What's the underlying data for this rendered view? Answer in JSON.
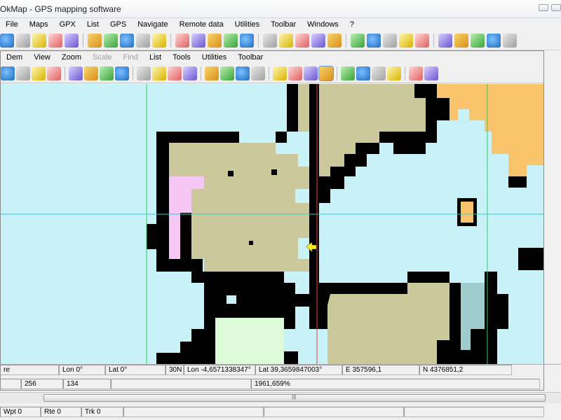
{
  "window": {
    "title": "OkMap - GPS mapping software"
  },
  "menubar": [
    "File",
    "Maps",
    "GPX",
    "List",
    "GPS",
    "Navigate",
    "Remote data",
    "Utilities",
    "Toolbar",
    "Windows",
    "?"
  ],
  "inner_menubar": [
    {
      "label": "Dem",
      "dim": false
    },
    {
      "label": "View",
      "dim": false
    },
    {
      "label": "Zoom",
      "dim": false
    },
    {
      "label": "Scale",
      "dim": true
    },
    {
      "label": "Find",
      "dim": true
    },
    {
      "label": "List",
      "dim": false
    },
    {
      "label": "Tools",
      "dim": false
    },
    {
      "label": "Utilities",
      "dim": false
    },
    {
      "label": "Toolbar",
      "dim": false
    }
  ],
  "main_toolbar_icons": [
    "open-map-icon",
    "save-map-icon",
    "calibrate-icon",
    "ecw-icon",
    "drg-icon",
    "georef-icon",
    "gps-receive-icon",
    "gps-send-icon",
    "gps-track-icon",
    "globe-icon",
    "globe-settings-icon",
    "layer-add-icon",
    "layer-remove-icon",
    "route-icon",
    "waypoint-icon",
    "track-icon",
    "measure-icon",
    "delete-icon",
    "find-icon",
    "pointer-icon",
    "select-icon",
    "edit-icon",
    "polygon-icon",
    "line-icon",
    "copy-icon",
    "paste-icon",
    "settings-icon",
    "print-icon",
    "exit-icon",
    "calc-icon"
  ],
  "inner_toolbar_icons": [
    "pencil-icon",
    "tools-icon",
    "grid-icon",
    "save-icon",
    "export-icon",
    "globe-icon",
    "shp-icon",
    "shp2-icon",
    "shp3-icon",
    "zoom-in-icon",
    "zoom-out-icon",
    "zoom-fit-icon",
    "properties-icon",
    "pointer-icon",
    "crosshair-icon",
    "smiley-icon",
    "label-icon",
    "path-icon",
    "node-icon",
    "polygon-icon",
    "edit-line-icon",
    "move-vertex-icon",
    "delete-vertex-icon",
    "ruler-icon",
    "distance-icon",
    "area-icon"
  ],
  "status": {
    "row1": [
      "re",
      "Lon 0°",
      "Lat 0°",
      "30N",
      "Lon -4,6571338347°",
      "Lat 39,3659847003°",
      "E 357596,1",
      "N 4376851,2"
    ],
    "row2": [
      "",
      "256",
      "134",
      "",
      "1961,659%"
    ],
    "row3": [
      "Wpt 0",
      "Rte 0",
      "Trk 0",
      "",
      "",
      ""
    ]
  },
  "colors": {
    "water": "#c8f2f8",
    "land": "#cbc89c",
    "border": "#000000",
    "pink": "#f6c6f4",
    "orange": "#f9c46b",
    "teal": "#9fcccc",
    "light_green": "#ddfad8",
    "grid_green": "#33cc66",
    "grid_cyan": "#33cccc",
    "meridian_red": "#e04040"
  },
  "map": {
    "cursor_icon": "arrow-marker-icon"
  }
}
